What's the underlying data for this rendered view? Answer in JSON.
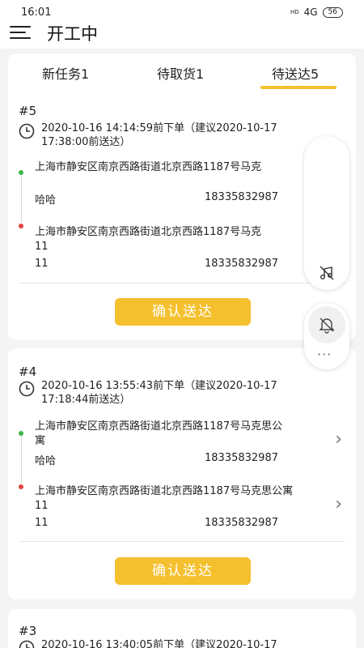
{
  "status_bar": {
    "time": "16:01",
    "hd": "HD",
    "network": "4G",
    "battery": "56"
  },
  "header": {
    "title": "开工中"
  },
  "tabs": [
    {
      "label": "新任务1",
      "active": false
    },
    {
      "label": "待取货1",
      "active": false
    },
    {
      "label": "待送达5",
      "active": true
    }
  ],
  "colors": {
    "accent": "#f5c02e",
    "pickup_dot": "#3bb54a",
    "dropoff_dot": "#e0443c"
  },
  "orders": [
    {
      "no": "#5",
      "time_line1": "2020-10-16 14:14:59前下单（建议2020-10-17",
      "time_line2": "17:38:00前送达）",
      "pickup": {
        "addr_line1": "上海市静安区南京西路街道北京西路1187号马克",
        "addr_line2": "",
        "name": "哈哈",
        "phone": "18335832987"
      },
      "dropoff": {
        "addr_line1": "上海市静安区南京西路街道北京西路1187号马克",
        "addr_line2": "11",
        "name": "11",
        "phone": "18335832987"
      },
      "button": "确认送达"
    },
    {
      "no": "#4",
      "time_line1": "2020-10-16 13:55:43前下单（建议2020-10-17",
      "time_line2": "17:18:44前送达）",
      "pickup": {
        "addr_line1": "上海市静安区南京西路街道北京西路1187号马克思公",
        "addr_line2": "寓",
        "name": "哈哈",
        "phone": "18335832987"
      },
      "dropoff": {
        "addr_line1": "上海市静安区南京西路街道北京西路1187号马克思公寓",
        "addr_line2": "11",
        "name": "11",
        "phone": "18335832987"
      },
      "button": "确认送达"
    },
    {
      "no": "#3",
      "time_line1": "2020-10-16 13:40:05前下单（建议2020-10-17"
    }
  ],
  "icons": {
    "menu": "menu-icon",
    "clock": "clock-icon",
    "chevron": "chevron-right-icon",
    "music_off": "music-off-icon",
    "bell_off": "bell-off-icon",
    "more": "more-icon"
  },
  "glyphs": {
    "chevron": "›",
    "more": "···"
  }
}
